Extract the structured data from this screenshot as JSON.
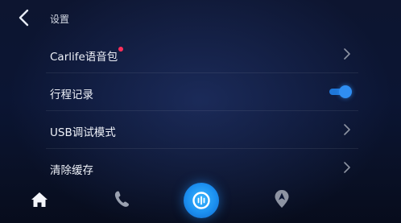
{
  "header": {
    "title": "设置",
    "back_icon": "chevron-left-icon"
  },
  "settings": {
    "items": [
      {
        "label": "Carlife语音包",
        "control": "chevron",
        "has_notification_dot": true
      },
      {
        "label": "行程记录",
        "control": "toggle",
        "toggle_on": true
      },
      {
        "label": "USB调试模式",
        "control": "chevron"
      },
      {
        "label": "清除缓存",
        "control": "chevron"
      }
    ]
  },
  "dock": {
    "items": [
      {
        "icon": "home-icon",
        "active": true
      },
      {
        "icon": "phone-icon",
        "active": false
      },
      {
        "icon": "voice-assistant-icon",
        "active": false
      },
      {
        "icon": "navigation-icon",
        "active": false
      }
    ]
  },
  "colors": {
    "background": "#0b1533",
    "accent": "#2f8ef2",
    "notification_dot": "#ff2f5a",
    "text": "#eef1f8"
  }
}
